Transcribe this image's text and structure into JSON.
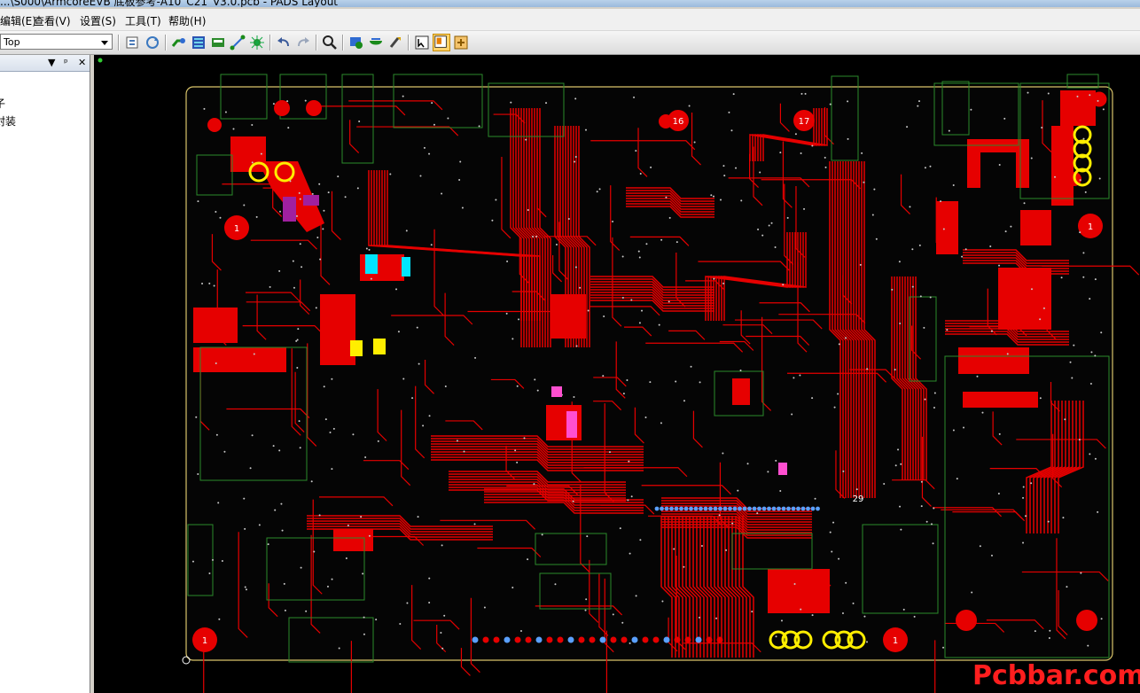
{
  "window": {
    "title": "...\\S000\\ArmcoreEVB 底板参考-A10_C21_V3.0.pcb - PADS Layout"
  },
  "menu": {
    "items": [
      {
        "label": "编辑(E)"
      },
      {
        "label": "查看(V)"
      },
      {
        "label": "设置(S)"
      },
      {
        "label": "工具(T)"
      },
      {
        "label": "帮助(H)"
      }
    ]
  },
  "toolbar": {
    "layer_value": "Top",
    "icons": [
      "properties-icon",
      "refresh-icon",
      "route-icon",
      "autoroute-icon",
      "design-rules-icon",
      "connect-icon",
      "cluster-icon",
      "undo-icon",
      "redo-icon",
      "zoom-icon",
      "layer-icon",
      "verify-icon",
      "paint-icon",
      "select-mode-icon",
      "board-view-icon",
      "options-icon"
    ]
  },
  "panel": {
    "controls": {
      "dropdown": "▼",
      "pin": "ᵖ",
      "close": "✕"
    },
    "items": [
      {
        "label": "子"
      },
      {
        "label": "封装"
      }
    ]
  },
  "board": {
    "mount_hole_label": "1",
    "part_labels": [
      "16",
      "17",
      "29"
    ]
  },
  "watermark": {
    "text": "Pcbbar.com"
  },
  "colors": {
    "copper": "#e60000",
    "silkscreen": "#2c8a2c",
    "via": "#5aa0ff",
    "pad_yellow": "#ffee00",
    "pad_cyan": "#00e5ff",
    "pad_pink": "#ff4fd0",
    "background": "#000000"
  }
}
